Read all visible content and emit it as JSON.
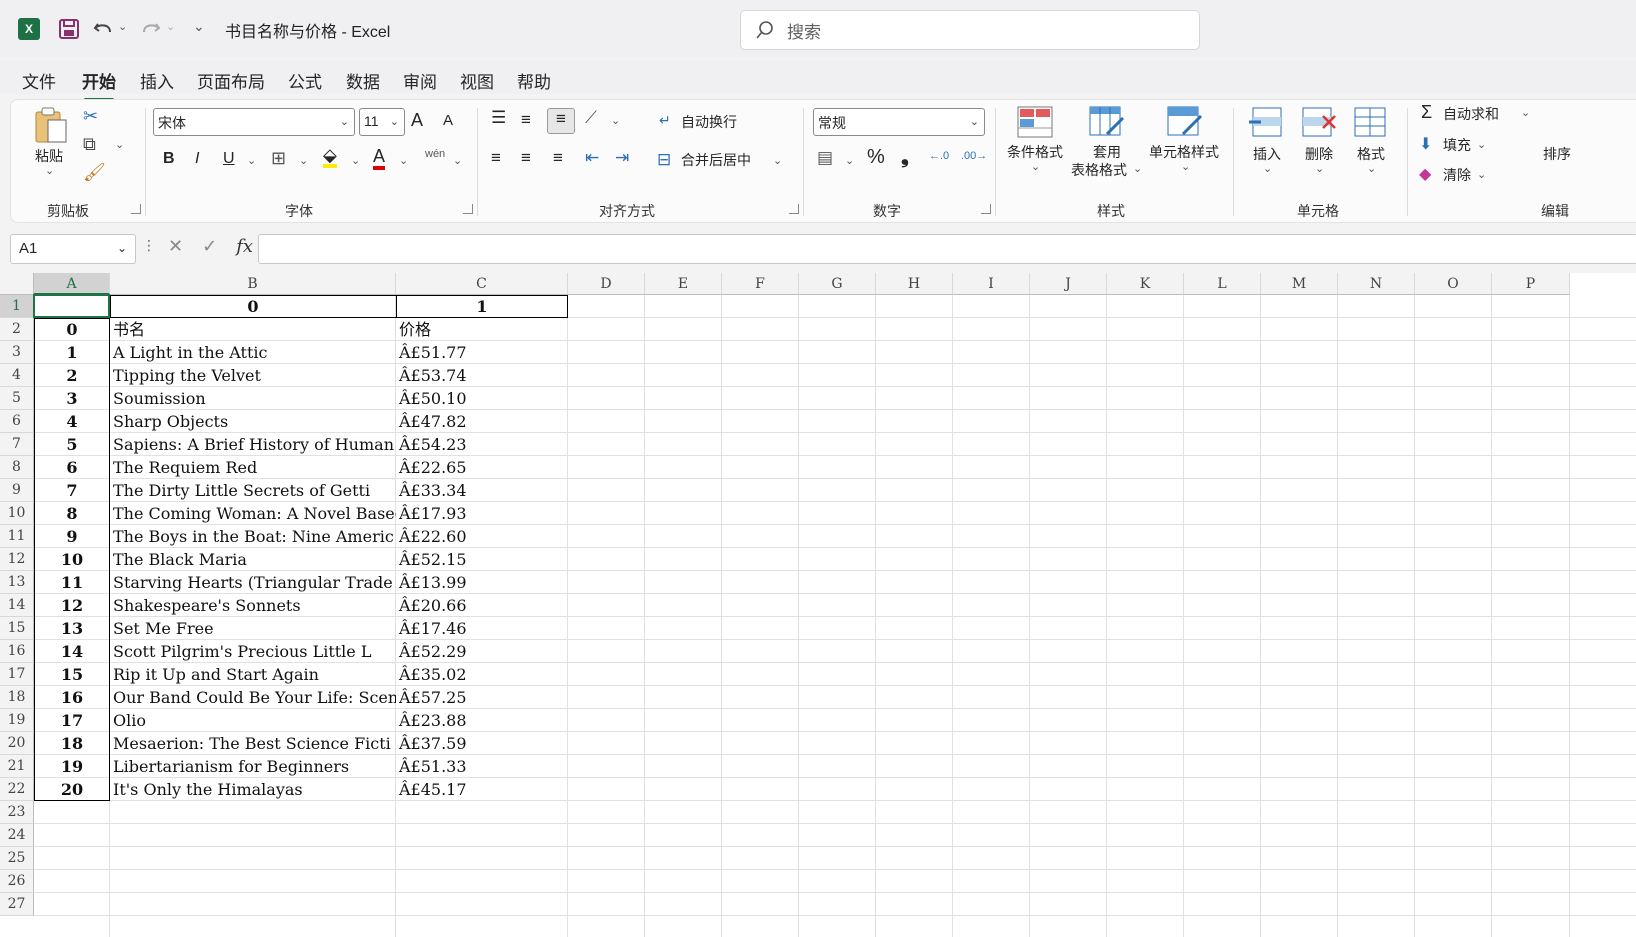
{
  "titlebar": {
    "app_icon": "X",
    "title": "书目名称与价格  -  Excel",
    "search_placeholder": "搜索"
  },
  "menu": [
    "文件",
    "开始",
    "插入",
    "页面布局",
    "公式",
    "数据",
    "审阅",
    "视图",
    "帮助"
  ],
  "menu_active": "开始",
  "ribbon": {
    "clipboard": {
      "paste": "粘贴",
      "group": "剪贴板"
    },
    "font": {
      "name": "宋体",
      "size": "11",
      "group": "字体",
      "bold": "B",
      "italic": "I",
      "underline": "U",
      "grow": "A",
      "shrink": "A",
      "color_letter": "A",
      "phonetic": "wén"
    },
    "alignment": {
      "wrap": "自动换行",
      "merge": "合并后居中",
      "group": "对齐方式"
    },
    "number": {
      "format": "常规",
      "group": "数字",
      "percent": "%",
      "comma": "❟"
    },
    "styles": {
      "conditional": "条件格式",
      "table_1": "套用",
      "table_2": "表格格式",
      "cell_styles": "单元格样式",
      "group": "样式"
    },
    "cells": {
      "insert": "插入",
      "delete": "删除",
      "format": "格式",
      "group": "单元格"
    },
    "editing": {
      "autosum": "自动求和",
      "fill": "填充",
      "clear": "清除",
      "sort": "排序",
      "group": "编辑"
    }
  },
  "formula_bar": {
    "name_box": "A1",
    "fx": "fx",
    "content": ""
  },
  "columns": [
    "A",
    "B",
    "C",
    "D",
    "E",
    "F",
    "G",
    "H",
    "I",
    "J",
    "K",
    "L",
    "M",
    "N",
    "O",
    "P"
  ],
  "rows": [
    "1",
    "2",
    "3",
    "4",
    "5",
    "6",
    "7",
    "8",
    "9",
    "10",
    "11",
    "12",
    "13",
    "14",
    "15",
    "16",
    "17",
    "18",
    "19",
    "20",
    "21",
    "22",
    "23",
    "24",
    "25",
    "26",
    "27"
  ],
  "sheet": {
    "header_row": [
      "",
      "0",
      "1"
    ],
    "data": [
      [
        "0",
        "书名",
        "价格"
      ],
      [
        "1",
        "A Light in the Attic",
        "Â£51.77"
      ],
      [
        "2",
        "Tipping the Velvet",
        "Â£53.74"
      ],
      [
        "3",
        "Soumission",
        "Â£50.10"
      ],
      [
        "4",
        "Sharp Objects",
        "Â£47.82"
      ],
      [
        "5",
        "Sapiens: A Brief History of Human",
        "Â£54.23"
      ],
      [
        "6",
        "The Requiem Red",
        "Â£22.65"
      ],
      [
        "7",
        "The Dirty Little Secrets of Getti",
        "Â£33.34"
      ],
      [
        "8",
        "The Coming Woman: A Novel Based o",
        "Â£17.93"
      ],
      [
        "9",
        "The Boys in the Boat: Nine Americ",
        "Â£22.60"
      ],
      [
        "10",
        "The Black Maria",
        "Â£52.15"
      ],
      [
        "11",
        "Starving Hearts (Triangular Trade",
        "Â£13.99"
      ],
      [
        "12",
        "Shakespeare's Sonnets",
        "Â£20.66"
      ],
      [
        "13",
        "Set Me Free",
        "Â£17.46"
      ],
      [
        "14",
        "Scott Pilgrim's Precious Little L",
        "Â£52.29"
      ],
      [
        "15",
        "Rip it Up and Start Again",
        "Â£35.02"
      ],
      [
        "16",
        "Our Band Could Be Your Life: Scen",
        "Â£57.25"
      ],
      [
        "17",
        "Olio",
        "Â£23.88"
      ],
      [
        "18",
        "Mesaerion: The Best Science Ficti",
        "Â£37.59"
      ],
      [
        "19",
        "Libertarianism for Beginners",
        "Â£51.33"
      ],
      [
        "20",
        "It's Only the Himalayas",
        "Â£45.17"
      ]
    ]
  }
}
